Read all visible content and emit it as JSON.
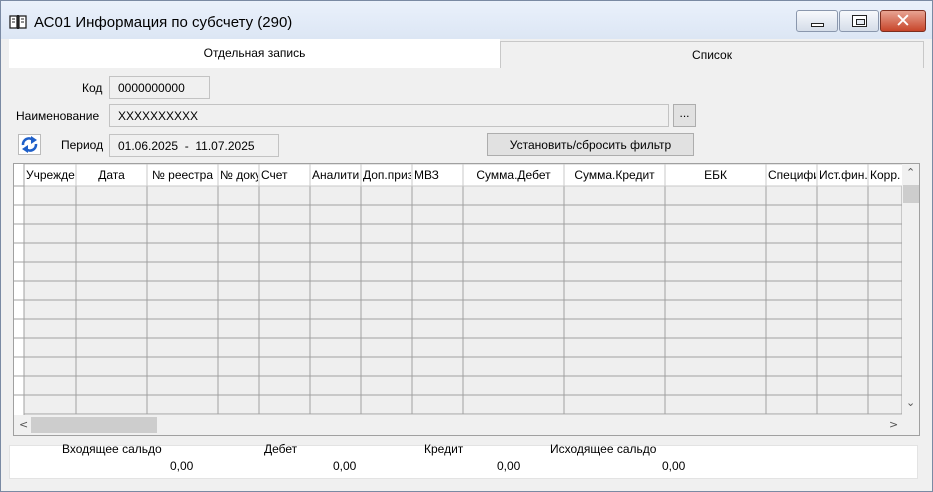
{
  "window": {
    "title": "АС01 Информация по субсчету (290)"
  },
  "tabs": [
    {
      "label": "Отдельная запись",
      "active": true
    },
    {
      "label": "Список",
      "active": false
    }
  ],
  "form": {
    "code_label": "Код",
    "code_value": "0000000000",
    "name_label": "Наименование",
    "name_value": "XXXXXXXXXX",
    "lookup_label": "...",
    "period_label": "Период",
    "period_value": "01.06.2025  -  11.07.2025",
    "filter_button_label": "Установить/сбросить фильтр"
  },
  "table": {
    "columns": [
      "Учрежде",
      "Дата",
      "№ реестра",
      "№ доку",
      "Счет",
      "Аналитич",
      "Доп.приз",
      "МВЗ",
      "Сумма.Дебет",
      "Сумма.Кредит",
      "ЕБК",
      "Специфи",
      "Ист.фин.",
      "Корр."
    ],
    "rows": [
      [
        "",
        "",
        "",
        "",
        "",
        "",
        "",
        "",
        "",
        "",
        "",
        "",
        "",
        ""
      ],
      [
        "",
        "",
        "",
        "",
        "",
        "",
        "",
        "",
        "",
        "",
        "",
        "",
        "",
        ""
      ],
      [
        "",
        "",
        "",
        "",
        "",
        "",
        "",
        "",
        "",
        "",
        "",
        "",
        "",
        ""
      ],
      [
        "",
        "",
        "",
        "",
        "",
        "",
        "",
        "",
        "",
        "",
        "",
        "",
        "",
        ""
      ],
      [
        "",
        "",
        "",
        "",
        "",
        "",
        "",
        "",
        "",
        "",
        "",
        "",
        "",
        ""
      ],
      [
        "",
        "",
        "",
        "",
        "",
        "",
        "",
        "",
        "",
        "",
        "",
        "",
        "",
        ""
      ],
      [
        "",
        "",
        "",
        "",
        "",
        "",
        "",
        "",
        "",
        "",
        "",
        "",
        "",
        ""
      ],
      [
        "",
        "",
        "",
        "",
        "",
        "",
        "",
        "",
        "",
        "",
        "",
        "",
        "",
        ""
      ],
      [
        "",
        "",
        "",
        "",
        "",
        "",
        "",
        "",
        "",
        "",
        "",
        "",
        "",
        ""
      ],
      [
        "",
        "",
        "",
        "",
        "",
        "",
        "",
        "",
        "",
        "",
        "",
        "",
        "",
        ""
      ],
      [
        "",
        "",
        "",
        "",
        "",
        "",
        "",
        "",
        "",
        "",
        "",
        "",
        "",
        ""
      ],
      [
        "",
        "",
        "",
        "",
        "",
        "",
        "",
        "",
        "",
        "",
        "",
        "",
        "",
        ""
      ]
    ]
  },
  "summary": {
    "opening_label": "Входящее сальдо",
    "opening_value": "0,00",
    "debit_label": "Дебет",
    "debit_value": "0,00",
    "credit_label": "Кредит",
    "credit_value": "0,00",
    "closing_label": "Исходящее сальдо",
    "closing_value": "0,00"
  },
  "colors": {
    "grid_row": "#efefef",
    "grid_line": "#a0a0a0",
    "close_button": "#c7452a"
  },
  "icons": {
    "app": "book-icon",
    "refresh": "refresh-icon",
    "minimize": "minimize-icon",
    "maximize": "maximize-icon",
    "close": "close-icon"
  }
}
